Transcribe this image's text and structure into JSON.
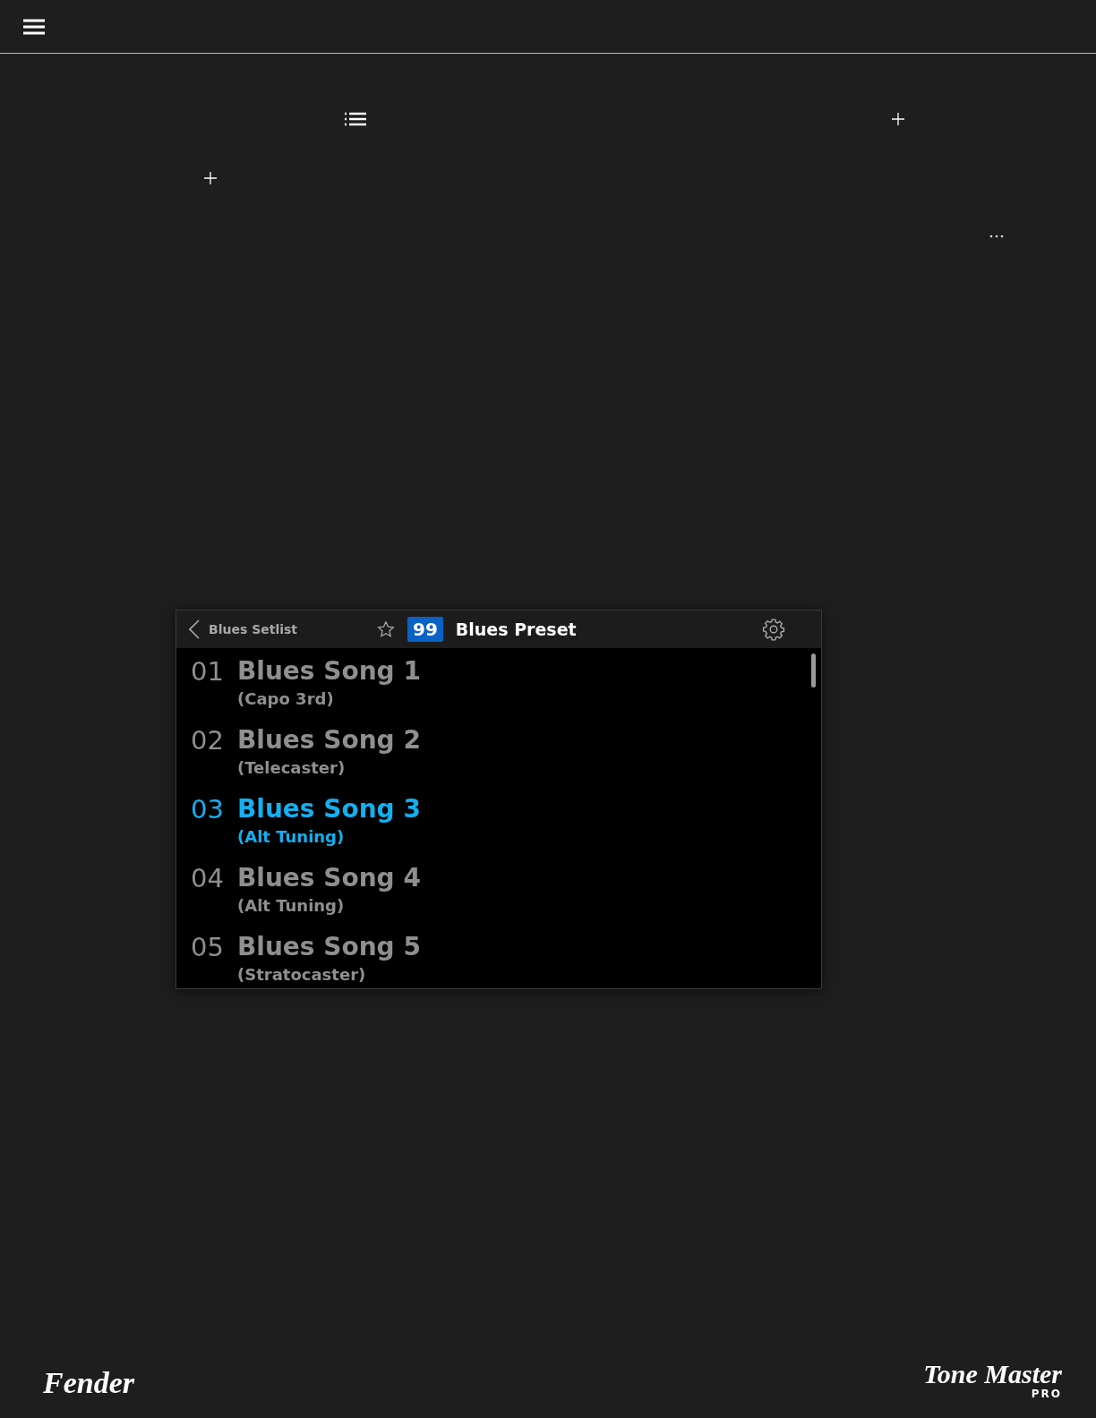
{
  "panel": {
    "back_label": "Blues Setlist",
    "favorite": false,
    "preset_number": "99",
    "preset_name": "Blues Preset",
    "songs": [
      {
        "number": "01",
        "title": "Blues Song 1",
        "note": "(Capo 3rd)",
        "selected": false
      },
      {
        "number": "02",
        "title": "Blues Song 2",
        "note": "(Telecaster)",
        "selected": false
      },
      {
        "number": "03",
        "title": "Blues Song 3",
        "note": "(Alt Tuning)",
        "selected": true
      },
      {
        "number": "04",
        "title": "Blues Song 4",
        "note": "(Alt Tuning)",
        "selected": false
      },
      {
        "number": "05",
        "title": "Blues Song 5",
        "note": "(Stratocaster)",
        "selected": false
      }
    ]
  },
  "footer": {
    "left_logo": "Fender",
    "right_logo": "Tone Master",
    "right_logo_sub": "PRO"
  }
}
